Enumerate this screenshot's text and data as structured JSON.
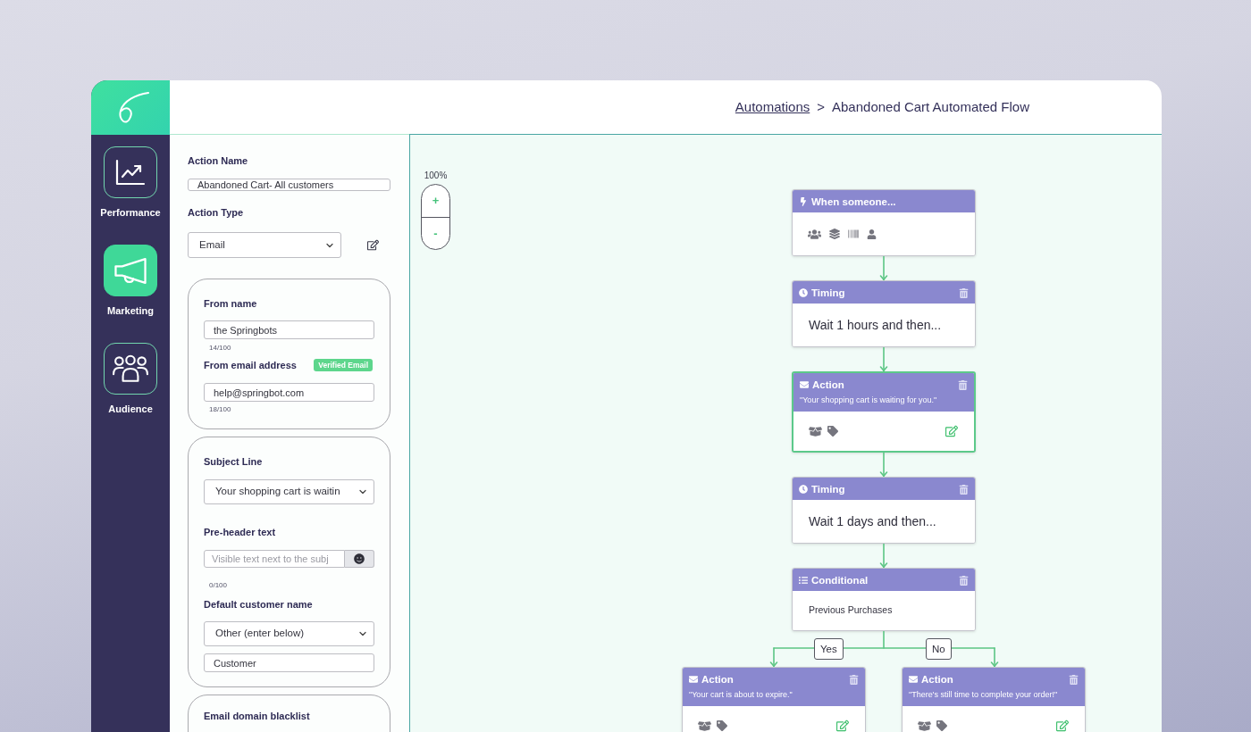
{
  "sidebar": {
    "nav": [
      {
        "label": "Performance",
        "selected": false
      },
      {
        "label": "Marketing",
        "selected": true
      },
      {
        "label": "Audience",
        "selected": false
      }
    ]
  },
  "header": {
    "breadcrumb": [
      {
        "kind": "link",
        "label": "Automations"
      },
      {
        "kind": "separator",
        "label": ">"
      },
      {
        "kind": "current",
        "label": "Abandoned Cart Automated Flow"
      }
    ]
  },
  "form": {
    "action_name": {
      "label": "Action Name",
      "value": "Abandoned Cart- All customers"
    },
    "action_type": {
      "label": "Action Type",
      "value": "Email"
    },
    "sender": {
      "from_name": {
        "label": "From name",
        "value": "the Springbots",
        "count": "14/100"
      },
      "from_email": {
        "label": "From email address",
        "badge": "Verified Email",
        "value": "help@springbot.com",
        "count": "18/100"
      }
    },
    "content": {
      "subject_line": {
        "label": "Subject Line",
        "value": "Your shopping cart is waitin"
      },
      "preheader": {
        "label": "Pre-header text",
        "placeholder": "Visible text next to the subj",
        "count": "0/100"
      },
      "default_name": {
        "label": "Default customer name",
        "value": "Other (enter below)",
        "custom_value": "Customer"
      }
    },
    "blacklist": {
      "label": "Email domain blacklist"
    }
  },
  "canvas": {
    "zoom": {
      "level_label": "100%",
      "zoom_in": "+",
      "zoom_out": "-"
    },
    "nodes": [
      {
        "kind": "trigger",
        "title": "When someone...",
        "selected": false
      },
      {
        "kind": "timing",
        "title": "Timing",
        "text": "Wait 1 hours and then...",
        "selected": false
      },
      {
        "kind": "action",
        "title": "Action",
        "subtitle": "\"Your shopping cart is waiting for you.\"",
        "selected": true
      },
      {
        "kind": "timing",
        "title": "Timing",
        "text": "Wait 1 days and then...",
        "selected": false
      },
      {
        "kind": "conditional",
        "title": "Conditional",
        "text": "Previous Purchases",
        "selected": false
      }
    ],
    "branches": [
      {
        "label": "Yes",
        "node": {
          "kind": "action",
          "title": "Action",
          "subtitle": "\"Your cart is about to expire.\"",
          "selected": false
        }
      },
      {
        "label": "No",
        "node": {
          "kind": "action",
          "title": "Action",
          "subtitle": "\"There's still time to complete your order!\"",
          "selected": false
        }
      }
    ]
  }
}
